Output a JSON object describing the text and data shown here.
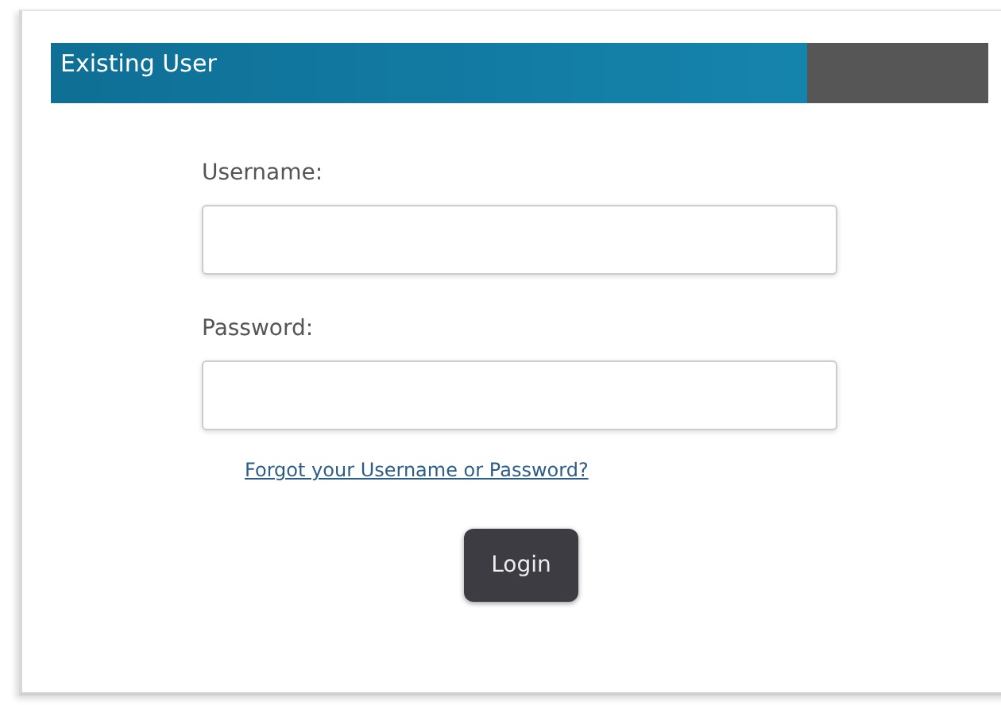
{
  "header": {
    "title": "Existing User"
  },
  "fields": [
    {
      "label": "Username:"
    },
    {
      "label": "Password:"
    }
  ],
  "forgot_link": "Forgot your Username or Password?",
  "login_button": "Login"
}
